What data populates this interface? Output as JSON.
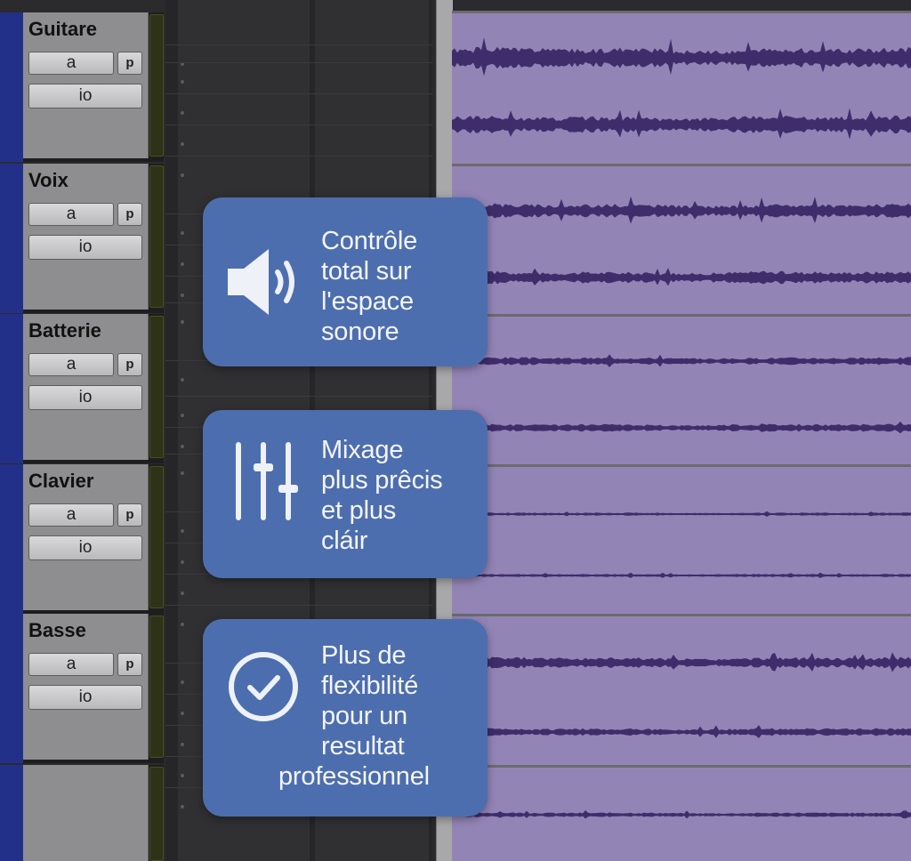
{
  "tracks": [
    {
      "name": "Guitare",
      "a_label": "a",
      "p_label": "p",
      "io_label": "io"
    },
    {
      "name": "Voix",
      "a_label": "a",
      "p_label": "p",
      "io_label": "io"
    },
    {
      "name": "Batterie",
      "a_label": "a",
      "p_label": "p",
      "io_label": "io"
    },
    {
      "name": "Clavier",
      "a_label": "a",
      "p_label": "p",
      "io_label": "io"
    },
    {
      "name": "Basse",
      "a_label": "a",
      "p_label": "p",
      "io_label": "io"
    }
  ],
  "cards": [
    {
      "icon": "speaker-icon",
      "lines": [
        "Contrôle",
        "total sur",
        "l'espace",
        "sonore"
      ]
    },
    {
      "icon": "sliders-icon",
      "lines": [
        "Mixage",
        "plus prêcis",
        "et plus",
        "cláir"
      ]
    },
    {
      "icon": "check-circle-icon",
      "lines": [
        "Plus de",
        "flexibilité",
        "pour un",
        "resultat",
        "professionnel"
      ]
    }
  ],
  "colors": {
    "track_color": "#23308a",
    "waveform_bg": "#9384b6",
    "waveform": "#3f2d6b",
    "card_bg": "#4d6eae",
    "meter": "#2d3218"
  }
}
